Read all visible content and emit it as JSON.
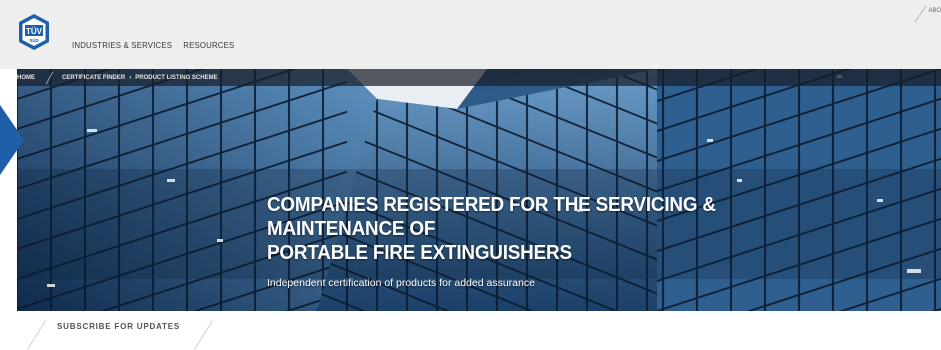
{
  "header": {
    "logo_text": "TÜV",
    "logo_subtext": "SÜD",
    "nav": [
      {
        "label": "INDUSTRIES & SERVICES"
      },
      {
        "label": "RESOURCES"
      }
    ],
    "top_right_link": "ABO"
  },
  "breadcrumb": {
    "items": [
      {
        "label": "HOME"
      },
      {
        "label": "CERTIFICATE FINDER"
      },
      {
        "label": "PRODUCT LISTING SCHEME"
      }
    ]
  },
  "hero": {
    "title_line1": "COMPANIES REGISTERED FOR THE SERVICING & MAINTENANCE OF",
    "title_line2": "PORTABLE FIRE EXTINGUISHERS",
    "subtitle": "Independent certification of products for added assurance"
  },
  "footer": {
    "subscribe_label": "SUBSCRIBE FOR UPDATES"
  },
  "colors": {
    "accent_blue": "#1d5fa8",
    "header_bg": "#eeeeee",
    "breadcrumb_bg": "#2a2f38"
  }
}
